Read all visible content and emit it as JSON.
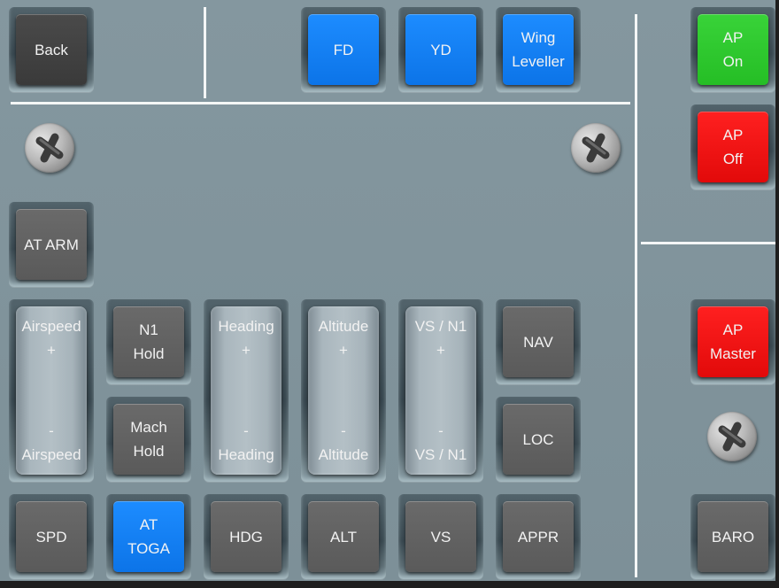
{
  "buttons": {
    "back": "Back",
    "fd": "FD",
    "yd": "YD",
    "wing_leveller": [
      "Wing",
      "Leveller"
    ],
    "ap_on": [
      "AP",
      "On"
    ],
    "ap_off": [
      "AP",
      "Off"
    ],
    "at_arm": "AT ARM",
    "n1_hold": [
      "N1",
      "Hold"
    ],
    "mach_hold": [
      "Mach",
      "Hold"
    ],
    "nav": "NAV",
    "loc": "LOC",
    "ap_master": [
      "AP",
      "Master"
    ],
    "spd": "SPD",
    "at_toga": [
      "AT",
      "TOGA"
    ],
    "hdg": "HDG",
    "alt": "ALT",
    "vs": "VS",
    "appr": "APPR",
    "baro": "BARO"
  },
  "rockers": {
    "airspeed": {
      "top": [
        "Airspeed",
        "+"
      ],
      "bottom": [
        "-",
        "Airspeed"
      ]
    },
    "heading": {
      "top": [
        "Heading",
        "+"
      ],
      "bottom": [
        "-",
        "Heading"
      ]
    },
    "altitude": {
      "top": [
        "Altitude",
        "+"
      ],
      "bottom": [
        "-",
        "Altitude"
      ]
    },
    "vs_n1": {
      "top": [
        "VS / N1",
        "+"
      ],
      "bottom": [
        "-",
        "VS / N1"
      ]
    }
  },
  "colors": {
    "panel": "#84979f",
    "button_gray": "#5f5f5f",
    "button_blue": "#0f7cf0",
    "button_green": "#2ac82a",
    "button_red": "#f01010",
    "divider": "#f4f6f6"
  },
  "icons": [
    "screw-icon"
  ]
}
